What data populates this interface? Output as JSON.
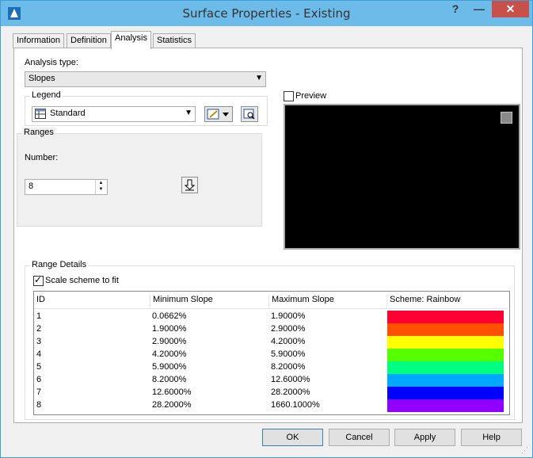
{
  "window": {
    "title": "Surface Properties - Existing",
    "close_glyph": "✕",
    "min_glyph": "—",
    "help_glyph": "?"
  },
  "tabs": [
    {
      "label": "Information"
    },
    {
      "label": "Definition"
    },
    {
      "label": "Analysis"
    },
    {
      "label": "Statistics"
    }
  ],
  "analysis": {
    "type_label": "Analysis type:",
    "type_value": "Slopes",
    "legend_label": "Legend",
    "legend_value": "Standard",
    "ranges_label": "Ranges",
    "number_label": "Number:",
    "number_value": "8",
    "preview_label": "Preview",
    "range_details_label": "Range Details",
    "scale_label": "Scale scheme to fit"
  },
  "table": {
    "columns": [
      "ID",
      "Minimum Slope",
      "Maximum Slope",
      "Scheme: Rainbow"
    ],
    "rows": [
      {
        "id": "1",
        "min": "0.0662%",
        "max": "1.9000%",
        "color": "#ff0033"
      },
      {
        "id": "2",
        "min": "1.9000%",
        "max": "2.9000%",
        "color": "#ff5000"
      },
      {
        "id": "3",
        "min": "2.9000%",
        "max": "4.2000%",
        "color": "#ffff00"
      },
      {
        "id": "4",
        "min": "4.2000%",
        "max": "5.9000%",
        "color": "#55ff00"
      },
      {
        "id": "5",
        "min": "5.9000%",
        "max": "8.2000%",
        "color": "#00ff80"
      },
      {
        "id": "6",
        "min": "8.2000%",
        "max": "12.6000%",
        "color": "#00a8ff"
      },
      {
        "id": "7",
        "min": "12.6000%",
        "max": "28.2000%",
        "color": "#0000ff"
      },
      {
        "id": "8",
        "min": "28.2000%",
        "max": "1660.1000%",
        "color": "#9000ff"
      }
    ]
  },
  "buttons": {
    "ok": "OK",
    "cancel": "Cancel",
    "apply": "Apply",
    "help": "Help"
  }
}
